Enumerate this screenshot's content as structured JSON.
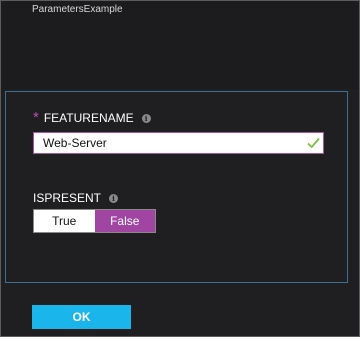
{
  "blade": {
    "subtitle": "ParametersExample"
  },
  "form": {
    "featurename": {
      "required_mark": "*",
      "label": "FEATURENAME",
      "info_icon": "info-icon",
      "value": "Web-Server",
      "valid_icon": "checkmark-icon"
    },
    "ispresent": {
      "label": "ISPRESENT",
      "info_icon": "info-icon",
      "options": [
        "True",
        "False"
      ],
      "selected": "False"
    }
  },
  "footer": {
    "ok_label": "OK"
  },
  "colors": {
    "background": "#1f1f22",
    "panel_border": "#3d6f96",
    "accent_purple": "#a045a2",
    "ok_button": "#1ab5ea",
    "valid_check": "#7cc043"
  }
}
